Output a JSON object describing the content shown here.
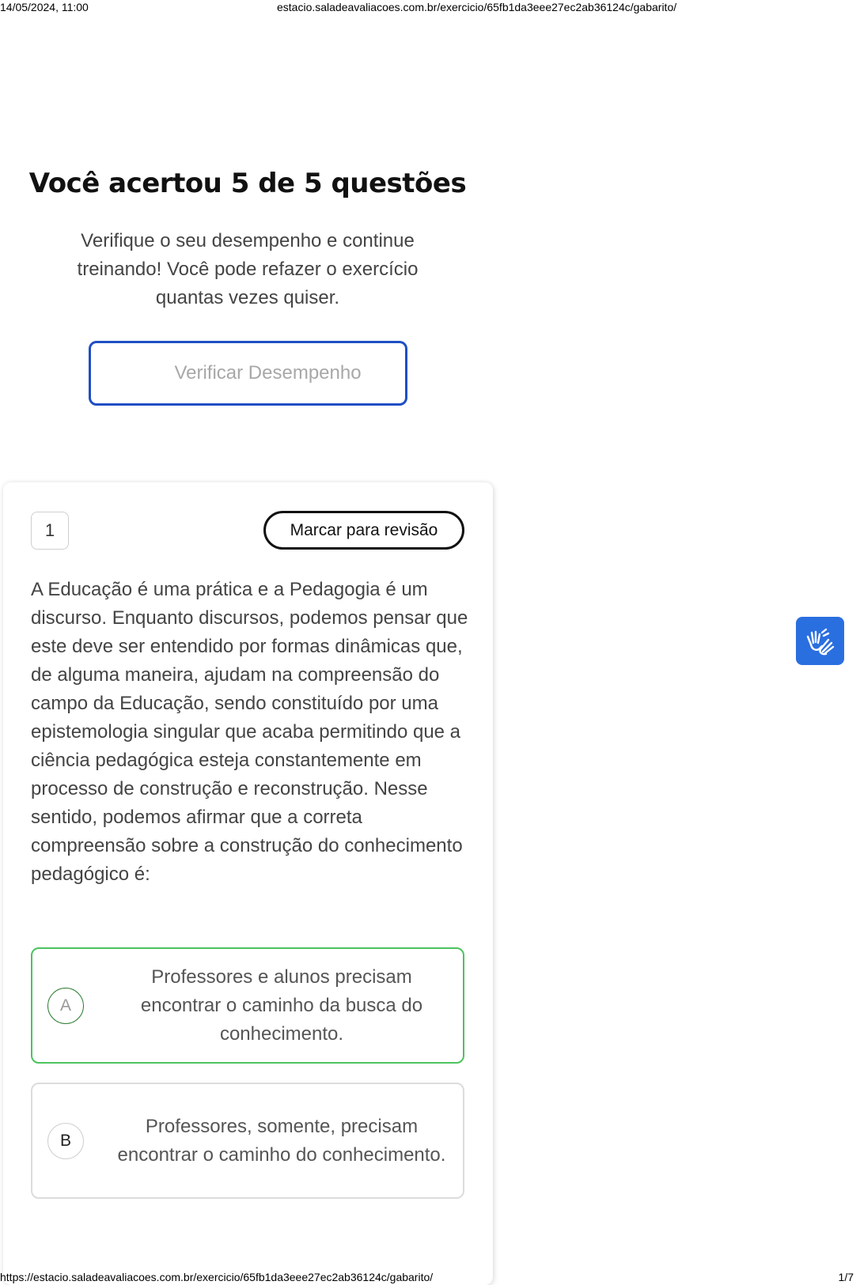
{
  "print_header": {
    "datetime": "14/05/2024, 11:00",
    "url": "estacio.saladeavaliacoes.com.br/exercicio/65fb1da3eee27ec2ab36124c/gabarito/"
  },
  "print_footer": {
    "url": "https://estacio.saladeavaliacoes.com.br/exercicio/65fb1da3eee27ec2ab36124c/gabarito/",
    "page": "1/7"
  },
  "result": {
    "title": "Você acertou 5 de 5 questões",
    "subtitle": "Verifique o seu desempenho e continue treinando! Você pode refazer o exercício quantas vezes quiser.",
    "verify_button": "Verificar Desempenho"
  },
  "question": {
    "number": "1",
    "mark_review_button": "Marcar para revisão",
    "text": "A Educação é uma prática e a Pedagogia é um discurso. Enquanto discursos, podemos pensar que este deve ser entendido por formas dinâmicas que, de alguma maneira, ajudam na compreensão do campo da Educação, sendo constituído por uma epistemologia singular que acaba permitindo que a ciência pedagógica esteja constantemente em processo de construção e reconstrução. Nesse sentido, podemos afirmar que a correta compreensão sobre a construção do conhecimento pedagógico é:",
    "options": [
      {
        "letter": "A",
        "text": "Professores e alunos precisam encontrar o caminho da busca do conhecimento.",
        "state": "correct"
      },
      {
        "letter": "B",
        "text": "Professores, somente, precisam encontrar o caminho do conhecimento.",
        "state": "neutral"
      }
    ]
  },
  "accessibility_widget": {
    "icon": "sign-language-hands-icon",
    "color": "#2a6fe0"
  },
  "colors": {
    "accent_blue": "#1f4fc4",
    "correct_green": "#4cc35e"
  }
}
